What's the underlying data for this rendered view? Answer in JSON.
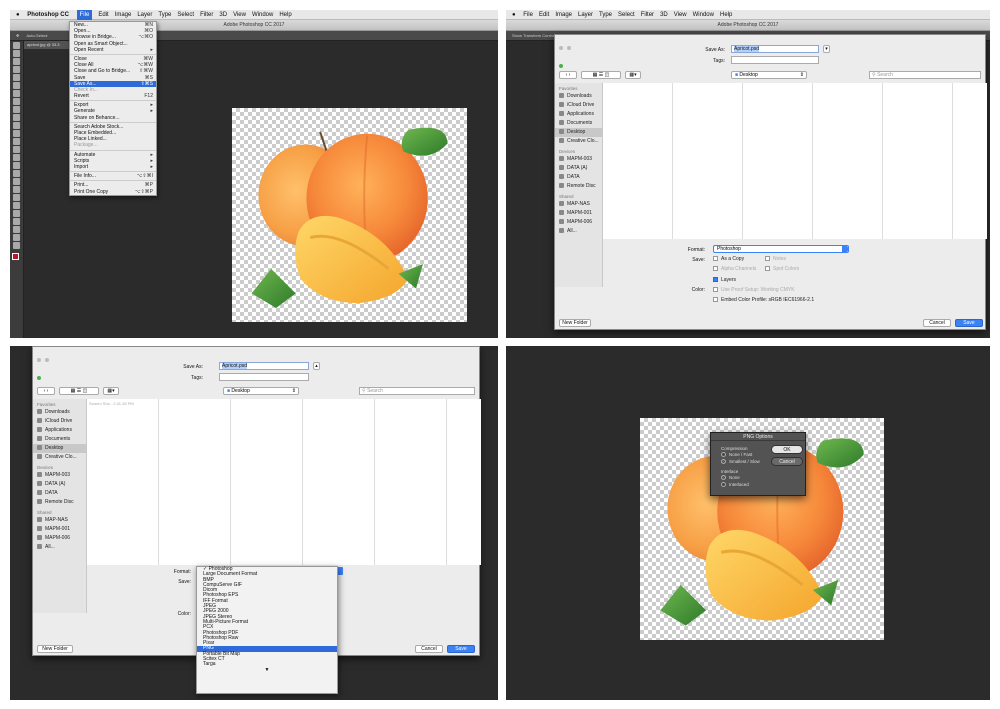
{
  "panel1": {
    "app_name": "Photoshop CC",
    "menubar": [
      "File",
      "Edit",
      "Image",
      "Layer",
      "Type",
      "Select",
      "Filter",
      "3D",
      "View",
      "Window",
      "Help"
    ],
    "window_title": "Adobe Photoshop CC 2017",
    "options_label": "Auto-Select:",
    "doc_tab": "apricot.jpg @ 33.3",
    "file_menu": [
      {
        "label": "New...",
        "shortcut": "⌘N"
      },
      {
        "label": "Open...",
        "shortcut": "⌘O"
      },
      {
        "label": "Browse in Bridge...",
        "shortcut": "⌥⌘O"
      },
      {
        "label": "Open as Smart Object...",
        "shortcut": ""
      },
      {
        "label": "Open Recent",
        "shortcut": "▸"
      },
      {
        "sep": true
      },
      {
        "label": "Close",
        "shortcut": "⌘W"
      },
      {
        "label": "Close All",
        "shortcut": "⌥⌘W"
      },
      {
        "label": "Close and Go to Bridge...",
        "shortcut": "⇧⌘W"
      },
      {
        "label": "Save",
        "shortcut": "⌘S"
      },
      {
        "label": "Save As...",
        "shortcut": "⇧⌘S",
        "selected": true
      },
      {
        "label": "Check In...",
        "shortcut": "",
        "disabled": true
      },
      {
        "label": "Revert",
        "shortcut": "F12"
      },
      {
        "sep": true
      },
      {
        "label": "Export",
        "shortcut": "▸"
      },
      {
        "label": "Generate",
        "shortcut": "▸"
      },
      {
        "label": "Share on Behance...",
        "shortcut": ""
      },
      {
        "sep": true
      },
      {
        "label": "Search Adobe Stock...",
        "shortcut": ""
      },
      {
        "label": "Place Embedded...",
        "shortcut": ""
      },
      {
        "label": "Place Linked...",
        "shortcut": ""
      },
      {
        "label": "Package...",
        "shortcut": "",
        "disabled": true
      },
      {
        "sep": true
      },
      {
        "label": "Automate",
        "shortcut": "▸"
      },
      {
        "label": "Scripts",
        "shortcut": "▸"
      },
      {
        "label": "Import",
        "shortcut": "▸"
      },
      {
        "sep": true
      },
      {
        "label": "File Info...",
        "shortcut": "⌥⇧⌘I"
      },
      {
        "sep": true
      },
      {
        "label": "Print...",
        "shortcut": "⌘P"
      },
      {
        "label": "Print One Copy",
        "shortcut": "⌥⇧⌘P"
      }
    ]
  },
  "panel2": {
    "window_title": "Adobe Photoshop CC 2017",
    "options_label": "Show Transform Controls",
    "save_as_label": "Save As:",
    "save_as_value": "Apricot.psd",
    "tags_label": "Tags:",
    "location": "Desktop",
    "search_placeholder": "Search",
    "favorites_header": "Favorites",
    "favorites": [
      "Downloads",
      "iCloud Drive",
      "Applications",
      "Documents",
      "Desktop",
      "Creative Clo..."
    ],
    "devices_header": "Devices",
    "devices": [
      "MAPM-003",
      "DATA (A)",
      "DATA",
      "Remote Disc"
    ],
    "shared_header": "Shared",
    "shared": [
      "MAP-NAS",
      "MAPM-001",
      "MAPM-006",
      "All..."
    ],
    "format_label": "Format:",
    "format_value": "Photoshop",
    "save_label": "Save:",
    "save_options": [
      {
        "label": "As a Copy",
        "checked": false,
        "disabled": false
      },
      {
        "label": "Notes",
        "checked": false,
        "disabled": true
      },
      {
        "label": "Alpha Channels",
        "checked": false,
        "disabled": true
      },
      {
        "label": "Spot Colors",
        "checked": false,
        "disabled": true
      },
      {
        "label": "Layers",
        "checked": true,
        "disabled": false
      }
    ],
    "color_label": "Color:",
    "proof_setup": "Use Proof Setup:  Working CMYK",
    "embed_profile": "Embed Color Profile:  sRGB IEC61966-2.1",
    "new_folder": "New Folder",
    "cancel": "Cancel",
    "save": "Save"
  },
  "panel3": {
    "save_as_label": "Save As:",
    "save_as_value": "Apricot.psd",
    "tags_label": "Tags:",
    "location": "Desktop",
    "search_placeholder": "Search",
    "file_item": "Screen Sho...2.01.28 PM",
    "favorites_header": "Favorites",
    "favorites": [
      "Downloads",
      "iCloud Drive",
      "Applications",
      "Documents",
      "Desktop",
      "Creative Clo..."
    ],
    "devices_header": "Devices",
    "devices": [
      "MAPM-003",
      "DATA (A)",
      "DATA",
      "Remote Disc"
    ],
    "shared_header": "Shared",
    "shared": [
      "MAP-NAS",
      "MAPM-001",
      "MAPM-006",
      "All..."
    ],
    "format_label": "Format:",
    "save_label": "Save:",
    "color_label": "Color:",
    "formats": [
      "✓ Photoshop",
      "Large Document Format",
      "BMP",
      "CompuServe GIF",
      "Dicom",
      "Photoshop EPS",
      "IFF Format",
      "JPEG",
      "JPEG 2000",
      "JPEG Stereo",
      "Multi-Picture Format",
      "PCX",
      "Photoshop PDF",
      "Photoshop Raw",
      "Pixar",
      "PNG",
      "Portable Bit Map",
      "Scitex CT",
      "Targa"
    ],
    "selected_format": "PNG",
    "more_arrow": "▼",
    "new_folder": "New Folder",
    "cancel": "Cancel",
    "save": "Save"
  },
  "panel4": {
    "dialog_title": "PNG Options",
    "compression_label": "Compression",
    "compression_options": [
      {
        "label": "None / Fast",
        "selected": false
      },
      {
        "label": "Smallest / Slow",
        "selected": true
      }
    ],
    "interlace_label": "Interlace",
    "interlace_options": [
      {
        "label": "None",
        "selected": true
      },
      {
        "label": "Interlaced",
        "selected": false
      }
    ],
    "ok": "OK",
    "cancel": "Cancel"
  },
  "colors": {
    "accent": "#2f6bd8",
    "save_button": "#3b82f6",
    "ps_dark": "#2b2b2b",
    "apricot": "#f59a3a",
    "leaf": "#3f8a32"
  }
}
